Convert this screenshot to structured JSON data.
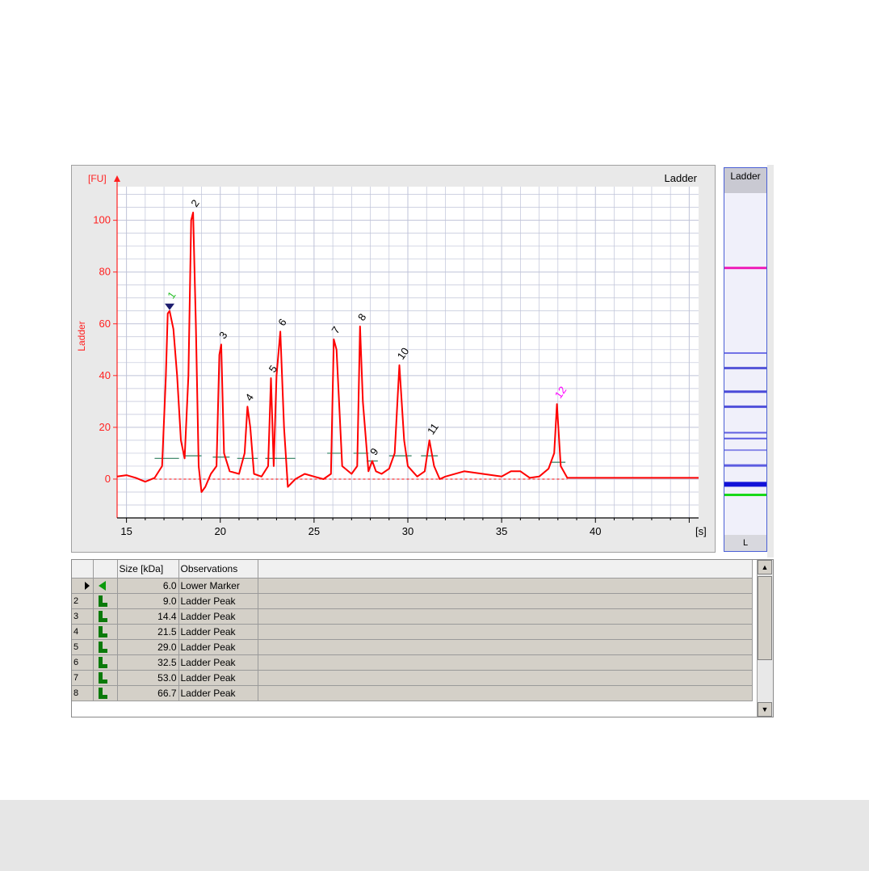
{
  "chart": {
    "title": "Ladder",
    "y_unit": "[FU]",
    "y_label": "Ladder",
    "x_unit": "[s]"
  },
  "chart_data": {
    "type": "line",
    "xlim": [
      14.5,
      45.5
    ],
    "ylim": [
      -15,
      113
    ],
    "x_ticks": [
      15,
      20,
      25,
      30,
      35,
      40
    ],
    "y_ticks": [
      0,
      20,
      40,
      60,
      80,
      100
    ],
    "grid": true,
    "series": [
      {
        "color": "#ff0000",
        "x": [
          14.5,
          15,
          15.5,
          16,
          16.5,
          16.9,
          17.1,
          17.2,
          17.3,
          17.5,
          17.7,
          17.9,
          18.1,
          18.3,
          18.45,
          18.55,
          18.7,
          18.85,
          19.0,
          19.2,
          19.5,
          19.8,
          19.95,
          20.05,
          20.2,
          20.5,
          21.0,
          21.3,
          21.45,
          21.6,
          21.8,
          22.2,
          22.55,
          22.7,
          22.85,
          23.0,
          23.2,
          23.4,
          23.6,
          24.0,
          24.5,
          25.0,
          25.5,
          25.9,
          26.05,
          26.2,
          26.5,
          27.0,
          27.3,
          27.45,
          27.6,
          27.9,
          28.1,
          28.3,
          28.6,
          29.0,
          29.3,
          29.55,
          29.8,
          30.0,
          30.5,
          30.9,
          31.15,
          31.4,
          31.7,
          32.0,
          33,
          34,
          35,
          35.5,
          36,
          36.5,
          37,
          37.5,
          37.8,
          37.95,
          38.15,
          38.5,
          39,
          40,
          41,
          42,
          43,
          44,
          45,
          45.5
        ],
        "y": [
          1,
          1.5,
          0.5,
          -1,
          0.5,
          5,
          40,
          64,
          65,
          58,
          40,
          15,
          8,
          40,
          100,
          103,
          60,
          5,
          -5,
          -3,
          2,
          5,
          48,
          52,
          10,
          3,
          2,
          10,
          28,
          20,
          2,
          1,
          5,
          39,
          5,
          40,
          57,
          20,
          -3,
          0,
          2,
          1,
          0,
          2,
          54,
          50,
          5,
          2,
          5,
          59,
          30,
          3,
          7,
          3,
          2,
          4,
          10,
          44,
          15,
          5,
          1,
          3,
          15,
          5,
          0,
          1,
          3,
          2,
          1,
          3,
          3,
          0.5,
          1,
          4,
          10,
          29,
          5,
          0.5,
          0.5,
          0.5,
          0.5,
          0.5,
          0.5,
          0.5,
          0.5,
          0.5
        ]
      }
    ],
    "peaks": [
      {
        "label": "1",
        "x": 17.3,
        "y": 65,
        "color": "#2ac02a",
        "marker": true
      },
      {
        "label": "2",
        "x": 18.55,
        "y": 103,
        "color": "#000000"
      },
      {
        "label": "3",
        "x": 20.05,
        "y": 52,
        "color": "#000000"
      },
      {
        "label": "4",
        "x": 21.45,
        "y": 28,
        "color": "#000000"
      },
      {
        "label": "5",
        "x": 22.7,
        "y": 39,
        "color": "#000000"
      },
      {
        "label": "6",
        "x": 23.2,
        "y": 57,
        "color": "#000000"
      },
      {
        "label": "7",
        "x": 26.05,
        "y": 54,
        "color": "#000000"
      },
      {
        "label": "8",
        "x": 27.45,
        "y": 59,
        "color": "#000000"
      },
      {
        "label": "9",
        "x": 28.1,
        "y": 7,
        "color": "#000000"
      },
      {
        "label": "10",
        "x": 29.55,
        "y": 44,
        "color": "#000000"
      },
      {
        "label": "11",
        "x": 31.15,
        "y": 15,
        "color": "#000000"
      },
      {
        "label": "12",
        "x": 37.95,
        "y": 29,
        "color": "#ff00ff"
      }
    ],
    "baselines": [
      {
        "x1": 16.5,
        "x2": 17.8,
        "y": 8
      },
      {
        "x1": 18.1,
        "x2": 19.0,
        "y": 9
      },
      {
        "x1": 19.6,
        "x2": 20.5,
        "y": 8.5
      },
      {
        "x1": 20.9,
        "x2": 22.0,
        "y": 8
      },
      {
        "x1": 22.4,
        "x2": 23.0,
        "y": 8
      },
      {
        "x1": 22.9,
        "x2": 24.0,
        "y": 8
      },
      {
        "x1": 25.7,
        "x2": 26.5,
        "y": 10
      },
      {
        "x1": 27.1,
        "x2": 27.9,
        "y": 10
      },
      {
        "x1": 27.8,
        "x2": 28.4,
        "y": 7
      },
      {
        "x1": 29.0,
        "x2": 30.2,
        "y": 9
      },
      {
        "x1": 30.7,
        "x2": 31.6,
        "y": 9
      },
      {
        "x1": 37.6,
        "x2": 38.4,
        "y": 6.5
      }
    ],
    "dashed_baseline": {
      "x1": 16.5,
      "x2": 38.5,
      "y": 0
    }
  },
  "gel": {
    "header": "Ladder",
    "footer": "L",
    "bands": [
      {
        "pos": 0.219,
        "color": "#ee1fb9",
        "w": 3
      },
      {
        "pos": 0.468,
        "color": "#7070e6",
        "w": 2
      },
      {
        "pos": 0.512,
        "color": "#5555d8",
        "w": 3
      },
      {
        "pos": 0.581,
        "color": "#4a4ad8",
        "w": 3
      },
      {
        "pos": 0.625,
        "color": "#5050da",
        "w": 3
      },
      {
        "pos": 0.701,
        "color": "#6060e0",
        "w": 2
      },
      {
        "pos": 0.718,
        "color": "#5a5ae0",
        "w": 2
      },
      {
        "pos": 0.752,
        "color": "#8a8ae8",
        "w": 2
      },
      {
        "pos": 0.797,
        "color": "#5c5ce0",
        "w": 3
      },
      {
        "pos": 0.852,
        "color": "#1212d8",
        "w": 6
      },
      {
        "pos": 0.883,
        "color": "#18d818",
        "w": 3
      }
    ]
  },
  "table": {
    "headers": [
      "",
      "",
      "Size [kDa]",
      "Observations",
      ""
    ],
    "rows": [
      {
        "num": "",
        "icon": "marker",
        "size": "6.0",
        "obs": "Lower Marker",
        "current": true
      },
      {
        "num": "2",
        "icon": "ladder",
        "size": "9.0",
        "obs": "Ladder Peak"
      },
      {
        "num": "3",
        "icon": "ladder",
        "size": "14.4",
        "obs": "Ladder Peak"
      },
      {
        "num": "4",
        "icon": "ladder",
        "size": "21.5",
        "obs": "Ladder Peak"
      },
      {
        "num": "5",
        "icon": "ladder",
        "size": "29.0",
        "obs": "Ladder Peak"
      },
      {
        "num": "6",
        "icon": "ladder",
        "size": "32.5",
        "obs": "Ladder Peak"
      },
      {
        "num": "7",
        "icon": "ladder",
        "size": "53.0",
        "obs": "Ladder Peak"
      },
      {
        "num": "8",
        "icon": "ladder",
        "size": "66.7",
        "obs": "Ladder Peak"
      }
    ]
  },
  "colors": {
    "trace": "#ff0000",
    "axis": "#ff2020",
    "grid": "#bfc3d8",
    "plot_bg": "#ffffff"
  }
}
